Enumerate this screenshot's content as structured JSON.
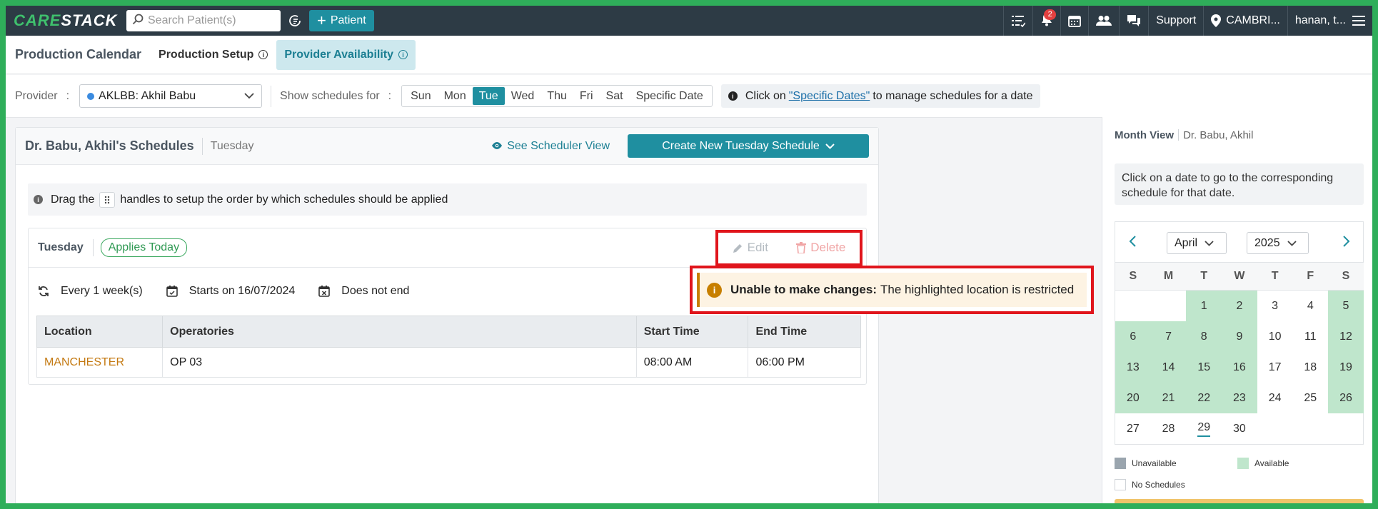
{
  "topbar": {
    "logo_a": "CARE",
    "logo_b": "STACK",
    "search_placeholder": "Search Patient(s)",
    "add_patient_label": "Patient",
    "notification_count": "2",
    "support_label": "Support",
    "location_label": "CAMBRI...",
    "user_label": "hanan, t..."
  },
  "tabs": {
    "page_title": "Production Calendar",
    "production_setup": "Production Setup",
    "provider_availability": "Provider Availability"
  },
  "filters": {
    "provider_label": "Provider",
    "colon": ":",
    "provider_value": "AKLBB: Akhil Babu",
    "show_label": "Show schedules for",
    "days": [
      "Sun",
      "Mon",
      "Tue",
      "Wed",
      "Thu",
      "Fri",
      "Sat",
      "Specific Date"
    ],
    "selected_day": "Tue",
    "notice_pre": "Click on",
    "notice_link": "\"Specific Dates\"",
    "notice_post": "to manage schedules for a date"
  },
  "main": {
    "title": "Dr. Babu, Akhil's Schedules",
    "day": "Tuesday",
    "scheduler_link": "See Scheduler View",
    "create_button": "Create New Tuesday Schedule",
    "drag_pre": "Drag the",
    "drag_post": "handles to setup the order by which schedules should be applied"
  },
  "schedule": {
    "day": "Tuesday",
    "applies_badge": "Applies Today",
    "edit_label": "Edit",
    "delete_label": "Delete",
    "recurrence": "Every 1 week(s)",
    "starts": "Starts on 16/07/2024",
    "ends": "Does not end",
    "warning_bold": "Unable to make changes:",
    "warning_text": "The highlighted location is restricted",
    "columns": [
      "Location",
      "Operatories",
      "Start Time",
      "End Time"
    ],
    "rows": [
      {
        "location": "MANCHESTER",
        "operatories": "OP 03",
        "start": "08:00 AM",
        "end": "06:00 PM"
      }
    ]
  },
  "side": {
    "view_label": "Month View",
    "provider_name": "Dr. Babu, Akhil",
    "hint": "Click on a date to go to the corresponding schedule for that date.",
    "month": "April",
    "year": "2025",
    "dow": [
      "S",
      "M",
      "T",
      "W",
      "T",
      "F",
      "S"
    ],
    "today": 29,
    "legend_unavailable": "Unavailable",
    "legend_available": "Available",
    "legend_none": "No Schedules"
  },
  "colors": {
    "accent": "#1f8fa0",
    "available": "#bfe6cc",
    "unavailable": "#9aa5ae",
    "warning": "#c77f00",
    "highlight": "#e0151c"
  },
  "icons": [
    "search-icon",
    "patient-lookup-icon",
    "task-list-icon",
    "bell-icon",
    "calendar-icon",
    "users-icon",
    "chat-icon",
    "location-pin-icon",
    "menu-icon",
    "info-icon",
    "eye-icon",
    "chevron-down-icon",
    "drag-handle-icon",
    "pencil-icon",
    "trash-icon",
    "repeat-icon",
    "calendar-start-icon",
    "calendar-end-icon",
    "warning-icon",
    "chevron-left-icon",
    "chevron-right-icon"
  ]
}
